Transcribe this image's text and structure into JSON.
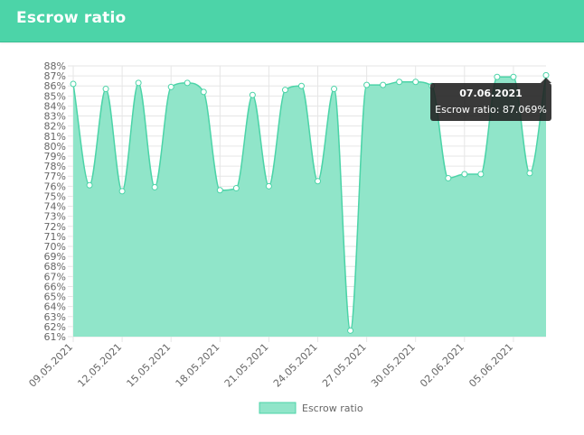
{
  "header": {
    "title": "Escrow ratio"
  },
  "colors": {
    "accent": "#4cd4a8",
    "fill": "#90e5c9",
    "line": "#4cd4a8",
    "tooltip_bg": "#1f1f1f"
  },
  "chart_data": {
    "type": "area",
    "title": "",
    "xlabel": "",
    "ylabel": "",
    "ylim": [
      61,
      88
    ],
    "grid": true,
    "legend": "bottom",
    "series": [
      {
        "name": "Escrow ratio",
        "x": [
          "09.05.2021",
          "10.05.2021",
          "11.05.2021",
          "12.05.2021",
          "13.05.2021",
          "14.05.2021",
          "15.05.2021",
          "16.05.2021",
          "17.05.2021",
          "18.05.2021",
          "19.05.2021",
          "20.05.2021",
          "21.05.2021",
          "22.05.2021",
          "23.05.2021",
          "24.05.2021",
          "25.05.2021",
          "26.05.2021",
          "27.05.2021",
          "28.05.2021",
          "29.05.2021",
          "30.05.2021",
          "31.05.2021",
          "01.06.2021",
          "02.06.2021",
          "03.06.2021",
          "04.06.2021",
          "05.06.2021",
          "06.06.2021",
          "07.06.2021"
        ],
        "values": [
          86.2,
          76.1,
          85.7,
          75.5,
          86.3,
          75.9,
          85.9,
          86.3,
          85.4,
          75.6,
          75.8,
          85.1,
          76.0,
          85.6,
          86.0,
          76.5,
          85.7,
          61.6,
          86.1,
          86.1,
          86.4,
          86.4,
          86.0,
          76.8,
          77.2,
          77.2,
          86.9,
          86.9,
          77.3,
          87.069
        ]
      }
    ],
    "y_ticks": [
      "88%",
      "87%",
      "86%",
      "85%",
      "84%",
      "83%",
      "82%",
      "81%",
      "80%",
      "79%",
      "78%",
      "77%",
      "76%",
      "75%",
      "74%",
      "73%",
      "72%",
      "71%",
      "70%",
      "69%",
      "68%",
      "67%",
      "66%",
      "65%",
      "64%",
      "63%",
      "62%",
      "61%"
    ],
    "x_ticks": [
      "09.05.2021",
      "12.05.2021",
      "15.05.2021",
      "18.05.2021",
      "21.05.2021",
      "24.05.2021",
      "27.05.2021",
      "30.05.2021",
      "02.06.2021",
      "05.06.2021"
    ],
    "tooltip": {
      "title": "07.06.2021",
      "body": "Escrow ratio: 87.069%"
    }
  }
}
